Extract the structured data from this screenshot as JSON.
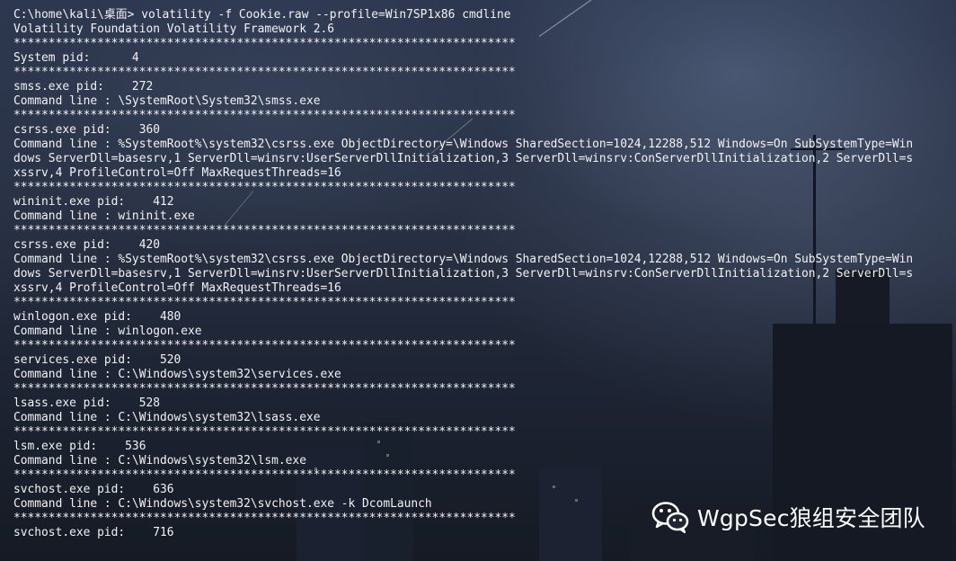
{
  "terminal": {
    "lines": [
      "C:\\home\\kali\\桌面> volatility -f Cookie.raw --profile=Win7SP1x86 cmdline",
      "Volatility Foundation Volatility Framework 2.6",
      "************************************************************************",
      "System pid:      4",
      "************************************************************************",
      "smss.exe pid:    272",
      "Command line : \\SystemRoot\\System32\\smss.exe",
      "************************************************************************",
      "csrss.exe pid:    360",
      "Command line : %SystemRoot%\\system32\\csrss.exe ObjectDirectory=\\Windows SharedSection=1024,12288,512 Windows=On SubSystemType=Win",
      "dows ServerDll=basesrv,1 ServerDll=winsrv:UserServerDllInitialization,3 ServerDll=winsrv:ConServerDllInitialization,2 ServerDll=s",
      "xssrv,4 ProfileControl=Off MaxRequestThreads=16",
      "************************************************************************",
      "wininit.exe pid:    412",
      "Command line : wininit.exe",
      "************************************************************************",
      "csrss.exe pid:    420",
      "Command line : %SystemRoot%\\system32\\csrss.exe ObjectDirectory=\\Windows SharedSection=1024,12288,512 Windows=On SubSystemType=Win",
      "dows ServerDll=basesrv,1 ServerDll=winsrv:UserServerDllInitialization,3 ServerDll=winsrv:ConServerDllInitialization,2 ServerDll=s",
      "xssrv,4 ProfileControl=Off MaxRequestThreads=16",
      "************************************************************************",
      "winlogon.exe pid:    480",
      "Command line : winlogon.exe",
      "************************************************************************",
      "services.exe pid:    520",
      "Command line : C:\\Windows\\system32\\services.exe",
      "************************************************************************",
      "lsass.exe pid:    528",
      "Command line : C:\\Windows\\system32\\lsass.exe",
      "************************************************************************",
      "lsm.exe pid:    536",
      "Command line : C:\\Windows\\system32\\lsm.exe",
      "************************************************************************",
      "svchost.exe pid:    636",
      "Command line : C:\\Windows\\system32\\svchost.exe -k DcomLaunch",
      "************************************************************************",
      "svchost.exe pid:    716"
    ],
    "text_color": "#f3f3f3"
  },
  "watermark": {
    "icon": "wechat-icon",
    "text": "WgpSec狼组安全团队"
  }
}
